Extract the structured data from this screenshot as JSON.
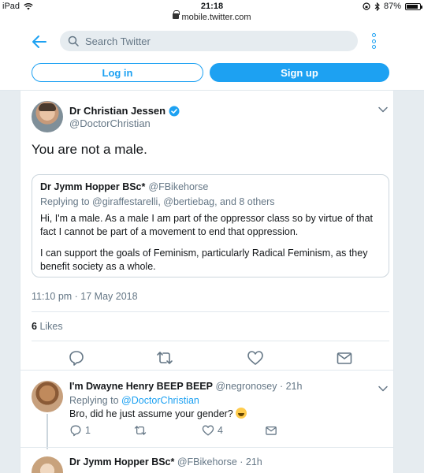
{
  "status_bar": {
    "device": "iPad",
    "time": "21:18",
    "url": "mobile.twitter.com",
    "battery": "87%",
    "battery_level": 0.87
  },
  "header": {
    "search_placeholder": "Search Twitter",
    "login_label": "Log in",
    "signup_label": "Sign up"
  },
  "tweet": {
    "author_name": "Dr Christian Jessen",
    "author_handle": "@DoctorChristian",
    "text": "You are not a male.",
    "quote": {
      "author_name": "Dr Jymm Hopper BSc*",
      "author_handle": "@FBikehorse",
      "replying_to": "Replying to @giraffestarelli, @bertiebag, and 8 others",
      "paragraph1": "Hi, I'm a male. As a male I am part of the oppressor class so by virtue of that fact I cannot be part of a movement to end that oppression.",
      "paragraph2": "I can support the goals of Feminism, particularly Radical Feminism, as they benefit society as a whole."
    },
    "timestamp": "11:10 pm · 17 May 2018",
    "likes_count": "6",
    "likes_label": "Likes"
  },
  "replies": [
    {
      "author_name": "I'm Dwayne Henry BEEP BEEP",
      "author_handle": "@negronosey",
      "time": "21h",
      "replying_prefix": "Replying to",
      "replying_handle": "@DoctorChristian",
      "text": "Bro, did he just assume your gender?",
      "reply_count": "1",
      "retweet_count": "",
      "like_count": "4"
    },
    {
      "author_name": "Dr Jymm Hopper BSc*",
      "author_handle": "@FBikehorse",
      "time": "21h"
    }
  ],
  "colors": {
    "accent": "#1da1f2",
    "secondary_text": "#657786",
    "background": "#e6ecf0"
  }
}
